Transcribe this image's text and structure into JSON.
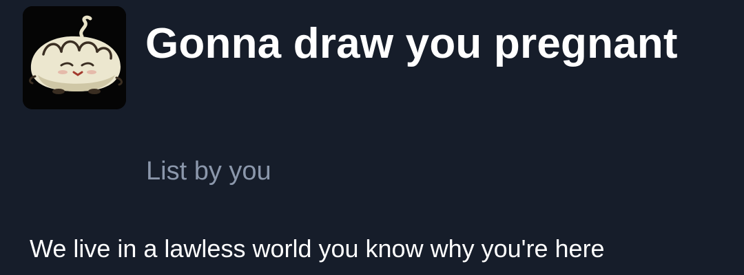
{
  "list": {
    "avatar_icon": "creature-avatar-icon",
    "title": "Gonna draw you pregnant",
    "owner_label": "List by you",
    "description": "We live in a lawless world you know why you're here"
  },
  "colors": {
    "background": "#161d2a",
    "title": "#ffffff",
    "subtitle": "#8b97ab",
    "description": "#ffffff"
  }
}
